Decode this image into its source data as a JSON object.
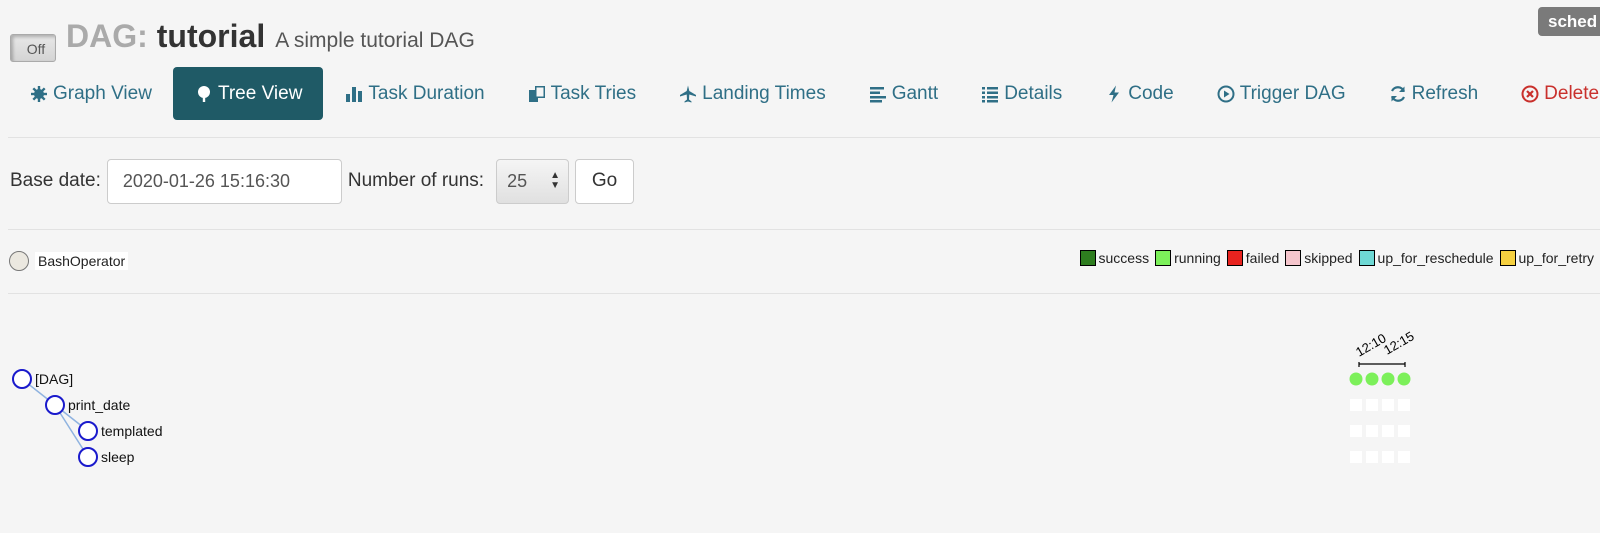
{
  "header": {
    "toggle_label": "Off",
    "prefix": "DAG:",
    "dag_id": "tutorial",
    "description": "A simple tutorial DAG",
    "badge": "sched"
  },
  "nav": [
    {
      "label": "Graph View",
      "icon": "asterisk-icon",
      "active": false
    },
    {
      "label": "Tree View",
      "icon": "tree-icon",
      "active": true
    },
    {
      "label": "Task Duration",
      "icon": "bar-chart-icon",
      "active": false
    },
    {
      "label": "Task Tries",
      "icon": "duplicate-icon",
      "active": false
    },
    {
      "label": "Landing Times",
      "icon": "plane-icon",
      "active": false
    },
    {
      "label": "Gantt",
      "icon": "align-left-icon",
      "active": false
    },
    {
      "label": "Details",
      "icon": "list-icon",
      "active": false
    },
    {
      "label": "Code",
      "icon": "flash-icon",
      "active": false
    },
    {
      "label": "Trigger DAG",
      "icon": "play-circle-icon",
      "active": false
    },
    {
      "label": "Refresh",
      "icon": "refresh-icon",
      "active": false
    },
    {
      "label": "Delete",
      "icon": "remove-circle-icon",
      "active": false
    }
  ],
  "form": {
    "base_date_label": "Base date:",
    "base_date_value": "2020-01-26 15:16:30",
    "runs_label": "Number of runs:",
    "runs_value": "25",
    "go_label": "Go"
  },
  "operator_legend": {
    "label": "BashOperator",
    "color": "#ebe8e0"
  },
  "state_legend": [
    {
      "label": "success",
      "color": "#2e7d1f"
    },
    {
      "label": "running",
      "color": "#7cf05a"
    },
    {
      "label": "failed",
      "color": "#e8231f"
    },
    {
      "label": "skipped",
      "color": "#f5c5cc"
    },
    {
      "label": "up_for_reschedule",
      "color": "#6ed8d4"
    },
    {
      "label": "up_for_retry",
      "color": "#f5d040"
    }
  ],
  "tree": {
    "nodes": [
      {
        "label": "[DAG]",
        "depth": 0
      },
      {
        "label": "print_date",
        "depth": 1
      },
      {
        "label": "templated",
        "depth": 2
      },
      {
        "label": "sleep",
        "depth": 2
      }
    ],
    "time_ticks": [
      "12:10",
      "12:15"
    ],
    "run_count": 4,
    "run_color": "#7cf05a"
  }
}
